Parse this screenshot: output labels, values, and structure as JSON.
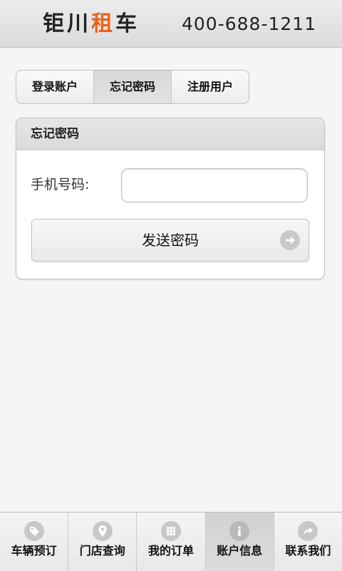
{
  "header": {
    "brand_part1": "钜川",
    "brand_accent": "租",
    "brand_part2": "车",
    "phone": "400-688-1211",
    "accent_color": "#e8631a"
  },
  "tabs": [
    {
      "label": "登录账户",
      "active": false
    },
    {
      "label": "忘记密码",
      "active": true
    },
    {
      "label": "注册用户",
      "active": false
    }
  ],
  "form": {
    "title": "忘记密码",
    "phone_label": "手机号码:",
    "phone_value": "",
    "phone_placeholder": "",
    "submit_label": "发送密码",
    "submit_icon": "arrow-right-circle-icon"
  },
  "bottom_nav": [
    {
      "label": "车辆预订",
      "icon": "tag-icon",
      "active": false
    },
    {
      "label": "门店查询",
      "icon": "map-pin-icon",
      "active": false
    },
    {
      "label": "我的订单",
      "icon": "grid-icon",
      "active": false
    },
    {
      "label": "账户信息",
      "icon": "info-icon",
      "active": true
    },
    {
      "label": "联系我们",
      "icon": "redo-arrow-icon",
      "active": false
    }
  ]
}
